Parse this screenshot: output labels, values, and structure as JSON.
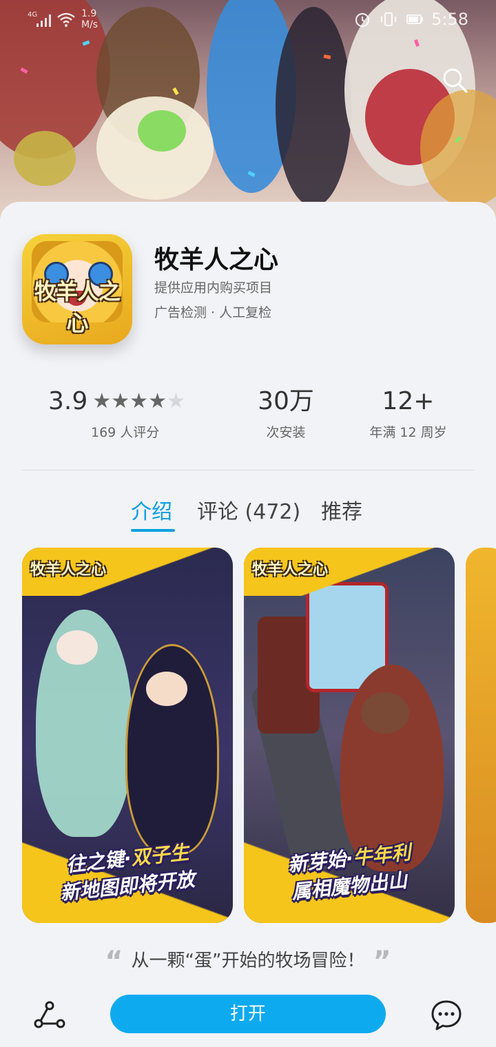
{
  "status_bar": {
    "network": "4G",
    "speed": "1.9\nM/s",
    "time": "5:58"
  },
  "app": {
    "icon_logo_text": "牧羊人之心",
    "name": "牧羊人之心",
    "subtitle": "提供应用内购买项目",
    "verification": "广告检测 · 人工复检"
  },
  "stats": {
    "rating": {
      "value": "3.9",
      "stars_filled": 4,
      "stars_total": 5,
      "label": "169 人评分"
    },
    "installs": {
      "value": "30万",
      "label": "次安装"
    },
    "age": {
      "value": "12+",
      "label": "年满 12 周岁"
    }
  },
  "tabs": [
    {
      "label": "介绍",
      "active": true
    },
    {
      "label": "评论 (472)",
      "active": false
    },
    {
      "label": "推荐",
      "active": false
    }
  ],
  "screenshots": [
    {
      "logo": "牧羊人之心",
      "caption_line1_a": "往之键·",
      "caption_line1_b": "双子生",
      "caption_line2": "新地图即将开放"
    },
    {
      "logo": "牧羊人之心",
      "caption_line1_a": "新芽始·",
      "caption_line1_b": "牛年利",
      "caption_line2": "属相魔物出山"
    },
    {
      "logo": "",
      "caption_line1_a": "",
      "caption_line1_b": "",
      "caption_line2": ""
    }
  ],
  "quote": {
    "open_mark": "“",
    "text": "从一颗“蛋”开始的牧场冒险！",
    "close_mark": "”"
  },
  "bottom_bar": {
    "open_label": "打开"
  },
  "colors": {
    "accent": "#0aa0de",
    "button": "#0eaaf0",
    "background": "#f2f3f7"
  },
  "icons": [
    "signal-icon",
    "wifi-icon",
    "battery-icon",
    "search-icon",
    "share-icon",
    "comment-icon",
    "star-icon"
  ]
}
